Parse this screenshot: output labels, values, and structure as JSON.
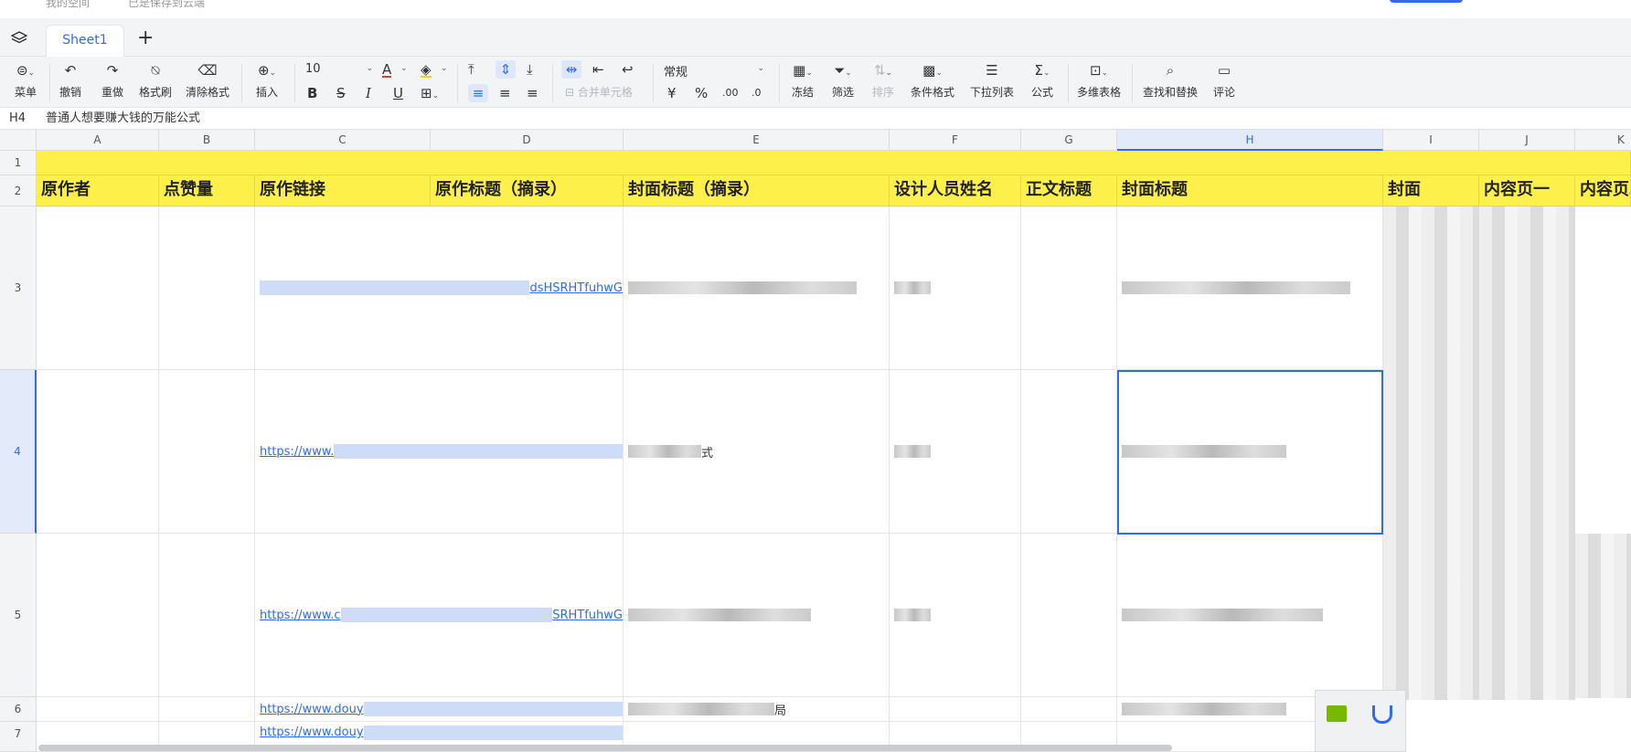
{
  "topbar": {
    "crumb1": "我的空间",
    "crumb2": "已是保存到云端"
  },
  "tabs": {
    "sheet1": "Sheet1",
    "add": "+"
  },
  "toolbar": {
    "menu": "菜单",
    "undo": "撤销",
    "redo": "重做",
    "format_painter": "格式刷",
    "clear_format": "清除格式",
    "insert": "插入",
    "font_size": "10",
    "merge_cells": "合并单元格",
    "number_format": "常规",
    "currency": "¥",
    "percent": "%",
    "dec_inc": ".00",
    "dec_dec": ".0",
    "freeze": "冻结",
    "filter": "筛选",
    "sort": "排序",
    "cond_format": "条件格式",
    "dropdown_list": "下拉列表",
    "formula": "公式",
    "multi_table": "多维表格",
    "find_replace": "查找和替换",
    "comment": "评论"
  },
  "formula_bar": {
    "cell_ref": "H4",
    "value": "普通人想要赚大钱的万能公式"
  },
  "columns": [
    "A",
    "B",
    "C",
    "D",
    "E",
    "F",
    "G",
    "H",
    "I",
    "J",
    "K"
  ],
  "rows": [
    "1",
    "2",
    "3",
    "4",
    "5",
    "6",
    "7"
  ],
  "headers": {
    "A": "原作者",
    "B": "点赞量",
    "C": "原作链接",
    "D": "原作标题（摘录）",
    "E": "封面标题（摘录）",
    "F": "设计人员姓名",
    "G": "正文标题",
    "H": "封面标题",
    "I": "封面",
    "J": "内容页一",
    "K": "内容页二"
  },
  "cells": {
    "C3_tail": "dsHSRHTfuhwG",
    "C4_link": "https://www.",
    "E4_tail": "式",
    "C5_link": "https://www.c",
    "C5_tail": "SRHTfuhwG",
    "C6_link": "https://www.douy",
    "E6_tail": "局",
    "C7_link": "https://www.douy"
  },
  "selection": {
    "column": "H",
    "row": "4"
  },
  "colors": {
    "accent": "#2f6bf0",
    "header_fill": "#fdf04a",
    "toolbar_bg": "#f3f4f6"
  }
}
